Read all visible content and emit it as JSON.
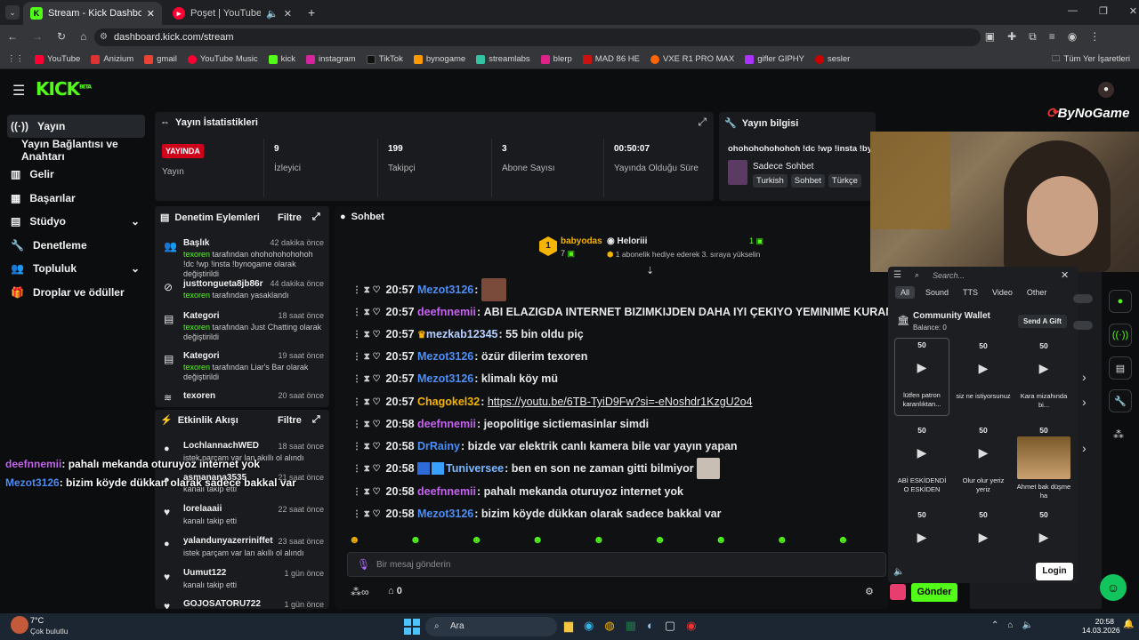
{
  "browser": {
    "tabs": [
      {
        "title": "Stream - Kick Dashboard",
        "active": true
      },
      {
        "title": "Poşet | YouTube Music",
        "active": false
      }
    ],
    "url": "dashboard.kick.com/stream",
    "bookmarks": [
      "YouTube",
      "Anizium",
      "gmail",
      "YouTube Music",
      "kick",
      "instagram",
      "TikTok",
      "bynogame",
      "streamlabs",
      "blerp",
      "MAD 86 HE",
      "VXE R1 PRO MAX",
      "gifler GIPHY",
      "sesler"
    ],
    "all_bookmarks": "Tüm Yer İşaretleri",
    "colors": {
      "kick_green": "#53fc18",
      "youtube_red": "#ff0033"
    }
  },
  "kick": {
    "logo": "KICK",
    "logo_tag": "BETA",
    "sidebar": [
      {
        "label": "Yayın",
        "icon": "stream-icon"
      },
      {
        "label": "Yayın Bağlantısı ve Anahtarı",
        "icon": ""
      },
      {
        "label": "Gelir",
        "icon": "bank-icon"
      },
      {
        "label": "Başarılar",
        "icon": "trophy-icon"
      },
      {
        "label": "Stüdyo",
        "icon": "studio-icon"
      },
      {
        "label": "Denetleme",
        "icon": "wrench-icon"
      },
      {
        "label": "Topluluk",
        "icon": "people-icon"
      },
      {
        "label": "Droplar ve ödüller",
        "icon": "gift-icon"
      }
    ],
    "stats": {
      "title": "Yayın İstatistikleri",
      "live_badge": "YAYINDA",
      "live_label": "Yayın",
      "items": [
        {
          "value": "9",
          "label": "İzleyici"
        },
        {
          "value": "199",
          "label": "Takipçi"
        },
        {
          "value": "3",
          "label": "Abone Sayısı"
        },
        {
          "value": "00:50:07",
          "label": "Yayında Olduğu Süre"
        }
      ]
    },
    "stream_info": {
      "title": "Yayın bilgisi",
      "stream_title": "ohohohohohohoh !dc !wp !insta !byı",
      "category": "Sadece Sohbet",
      "tags": [
        "Turkish",
        "Sohbet",
        "Türkçe"
      ]
    },
    "mod_actions": {
      "title": "Denetim Eylemleri",
      "filter": "Filtre",
      "items": [
        {
          "title": "Başlık",
          "time": "42 dakika önce",
          "user": "texoren",
          "text": "tarafından ohohohohohohoh !dc !wp !insta !bynogame olarak değiştirildi",
          "icon": "users-icon"
        },
        {
          "title": "justtongueta8jb86r",
          "time": "44 dakika önce",
          "user": "texoren",
          "text": "tarafından yasaklandı",
          "icon": "ban-icon"
        },
        {
          "title": "Kategori",
          "time": "18 saat önce",
          "user": "texoren",
          "text": "tarafından Just Chatting olarak değiştirildi",
          "icon": "category-icon"
        },
        {
          "title": "Kategori",
          "time": "19 saat önce",
          "user": "texoren",
          "text": "tarafından Liar's Bar olarak değiştirildi",
          "icon": "category-icon"
        },
        {
          "title": "texoren",
          "time": "20 saat önce",
          "user": "",
          "text": "",
          "icon": "wifi-icon"
        }
      ]
    },
    "activity": {
      "title": "Etkinlik Akışı",
      "filter": "Filtre",
      "items": [
        {
          "name": "LochlannachWED",
          "time": "18 saat önce",
          "text": "istek parçam var lan akıllı ol alındı",
          "icon": "points-icon"
        },
        {
          "name": "asmanana3535",
          "time": "21 saat önce",
          "text": "kanalı takip etti",
          "icon": "points-icon"
        },
        {
          "name": "lorelaaaii",
          "time": "22 saat önce",
          "text": "kanalı takip etti",
          "icon": "heart-icon"
        },
        {
          "name": "yalandunyazerriniffet",
          "time": "23 saat önce",
          "text": "istek parçam var lan akıllı ol alındı",
          "icon": "points-icon"
        },
        {
          "name": "Uumut122",
          "time": "1 gün önce",
          "text": "kanalı takip etti",
          "icon": "heart-icon"
        },
        {
          "name": "GOJOSATORU722",
          "time": "1 gün önce",
          "text": "",
          "icon": "heart-icon"
        }
      ]
    },
    "chat": {
      "title": "Sohbet",
      "pinned": {
        "user1": "babyodas",
        "count1": "7",
        "user2": "Heloriii",
        "count2": "1",
        "text": "1 abonelik hediye ederek 3. sıraya yükselin"
      },
      "messages": [
        {
          "time": "20:57",
          "user": "Mezot3126",
          "color": "#4b8ef5",
          "text": ""
        },
        {
          "time": "20:57",
          "user": "deefnnemii",
          "color": "#c564ef",
          "text": "ABI ELAZIGDA INTERNET BIZIMKIJDEN DAHA IYI ÇEKIYO YEMINIME KURAN"
        },
        {
          "time": "20:57",
          "user": "mezkab12345",
          "color": "#b7d0ff",
          "text": "55 bin oldu piç"
        },
        {
          "time": "20:57",
          "user": "Mezot3126",
          "color": "#4b8ef5",
          "text": "özür dilerim texoren"
        },
        {
          "time": "20:57",
          "user": "Mezot3126",
          "color": "#4b8ef5",
          "text": "klimalı köy mü"
        },
        {
          "time": "20:57",
          "user": "Chagokel32",
          "color": "#f5b400",
          "text": "https://youtu.be/6TB-TyiD9Fw?si=-eNoshdr1KzgU2o4"
        },
        {
          "time": "20:58",
          "user": "deefnnemii",
          "color": "#c564ef",
          "text": "jeopolitige sictiemasinlar simdi"
        },
        {
          "time": "20:58",
          "user": "DrRainy",
          "color": "#4b8ef5",
          "text": "bizde var elektrik canlı kamera bile var yayın yapan"
        },
        {
          "time": "20:58",
          "user": "Tuniversee",
          "color": "#7ab8ff",
          "text": "ben en son ne zaman gitti bilmiyor"
        },
        {
          "time": "20:58",
          "user": "deefnnemii",
          "color": "#c564ef",
          "text": "pahalı mekanda oturuyoz internet yok"
        },
        {
          "time": "20:58",
          "user": "Mezot3126",
          "color": "#4b8ef5",
          "text": "bizim köyde dükkan olarak sadece bakkal var"
        }
      ],
      "input_placeholder": "Bir mesaj gönderin",
      "points": "0",
      "send": "Gönder"
    },
    "overlay_chat": [
      {
        "user": "deefnnemii",
        "text": ": pahalı mekanda oturuyoz internet yok"
      },
      {
        "user": "Mezot3126",
        "text": ": bizim köyde dükkan olarak sadece bakkal var"
      }
    ]
  },
  "soundboard": {
    "search_placeholder": "Search...",
    "tabs": [
      "All",
      "Sound",
      "TTS",
      "Video",
      "Other"
    ],
    "wallet_title": "Community Wallet",
    "balance": "Balance: 0",
    "send_gift": "Send A Gift",
    "tiles": [
      {
        "cost": "50",
        "label": "lütfen patron karanlıktan..."
      },
      {
        "cost": "50",
        "label": "siz ne istiyorsunuz"
      },
      {
        "cost": "50",
        "label": "Kara mizahında bi..."
      },
      {
        "cost": "50",
        "label": "ABİ ESKİDENDİ O ESKİDEN"
      },
      {
        "cost": "50",
        "label": "Olur olur yeriz yeriz"
      },
      {
        "cost": "50",
        "label": "Ahmet bak düşme ha"
      },
      {
        "cost": "50",
        "label": ""
      },
      {
        "cost": "50",
        "label": ""
      },
      {
        "cost": "50",
        "label": ""
      }
    ],
    "login": "Login"
  },
  "watermark": "ByNoGame",
  "taskbar": {
    "weather_temp": "7°C",
    "weather_desc": "Çok bulutlu",
    "search": "Ara",
    "clock_time": "20:58",
    "clock_date": "14.03.2026"
  }
}
